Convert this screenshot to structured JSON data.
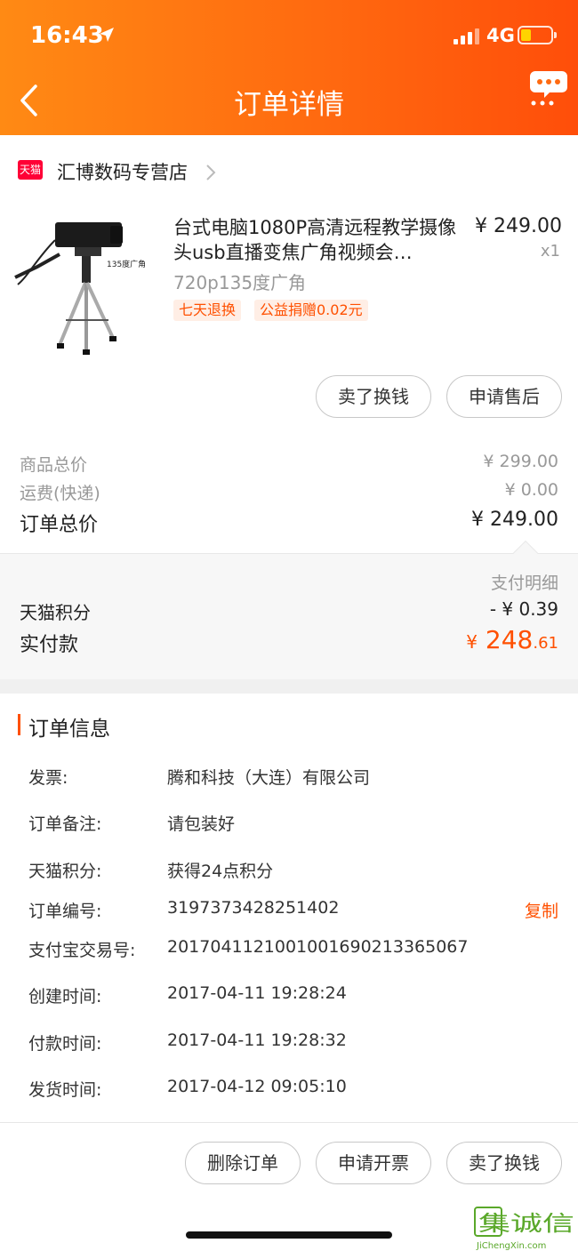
{
  "status_bar": {
    "time": "16:43",
    "network": "4G"
  },
  "nav": {
    "title": "订单详情"
  },
  "shop": {
    "badge": "天猫",
    "name": "汇博数码专营店"
  },
  "product": {
    "image_caption": "135度广角",
    "name": "台式电脑1080P高清远程教学摄像头usb直播变焦广角视频会…",
    "price": "¥ 249.00",
    "quantity": "x1",
    "sku": "720p135度广角",
    "tags": [
      "七天退换",
      "公益捐赠0.02元"
    ]
  },
  "item_actions": [
    "卖了换钱",
    "申请售后"
  ],
  "summary": {
    "goods_total_label": "商品总价",
    "goods_total_value": "¥ 299.00",
    "shipping_label": "运费(快递)",
    "shipping_value": "¥ 0.00",
    "order_total_label": "订单总价",
    "order_total_value": "¥ 249.00"
  },
  "payment": {
    "detail_link": "支付明细",
    "points_label": "天猫积分",
    "points_value": "- ¥ 0.39",
    "actual_label": "实付款",
    "actual_currency": "¥",
    "actual_int": " 248",
    "actual_dec": ".61"
  },
  "order_info": {
    "title": "订单信息",
    "rows": [
      {
        "label": "发票:",
        "value": "腾和科技（大连）有限公司"
      },
      {
        "label": "订单备注:",
        "value": "请包装好"
      },
      {
        "label": "天猫积分:",
        "value": "获得24点积分"
      },
      {
        "label": "订单编号:",
        "value": "3197373428251402",
        "action": "复制"
      },
      {
        "label": "支付宝交易号:",
        "value": "2017041121001001690213365067"
      },
      {
        "label": "创建时间:",
        "value": "2017-04-11 19:28:24"
      },
      {
        "label": "付款时间:",
        "value": "2017-04-11 19:28:32"
      },
      {
        "label": "发货时间:",
        "value": "2017-04-12 09:05:10"
      }
    ]
  },
  "footer_actions": [
    "删除订单",
    "申请开票",
    "卖了换钱"
  ],
  "watermark": {
    "cn": "集诚信",
    "url": "JiChengXin.com"
  },
  "colors": {
    "accent": "#ff5000",
    "header_start": "#ff8a14",
    "header_end": "#ff4e0a",
    "tmall_red": "#ff0036"
  }
}
